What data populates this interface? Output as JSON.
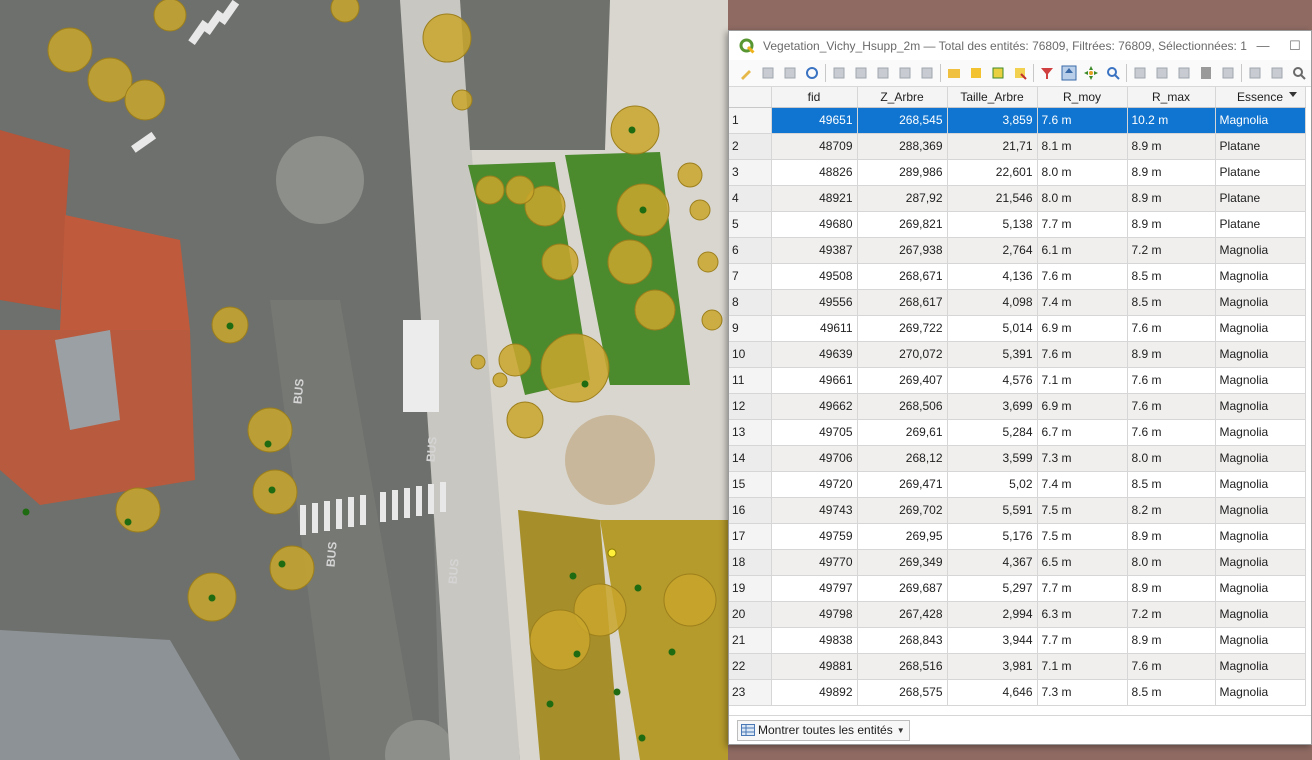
{
  "window": {
    "title": "Vegetation_Vichy_Hsupp_2m — Total des entités: 76809, Filtrées: 76809, Sélectionnées: 1",
    "minimize_glyph": "—",
    "maximize_glyph": "☐"
  },
  "toolbar": {
    "icons": [
      "toggle-editing-pencil-icon",
      "multi-edit-icon",
      "save-edits-icon",
      "reload-icon",
      "add-feature-icon",
      "delete-feature-icon",
      "cut-icon",
      "copy-icon",
      "paste-icon",
      "select-by-expression-icon",
      "select-all-icon",
      "invert-selection-icon",
      "deselect-all-icon",
      "filter-icon",
      "move-selection-to-top-icon",
      "pan-map-icon",
      "zoom-to-selection-icon",
      "copy-selected-rows-icon",
      "paste-features-icon",
      "delete-field-icon",
      "field-calculator-icon",
      "conditional-formatting-icon",
      "dock-table-icon",
      "table-view-icon",
      "form-view-icon"
    ]
  },
  "table": {
    "columns": [
      "fid",
      "Z_Arbre",
      "Taille_Arbre",
      "R_moy",
      "R_max",
      "Essence"
    ],
    "selected_row": 1,
    "rows": [
      [
        "1",
        "49651",
        "268,545",
        "3,859",
        "7.6 m",
        "10.2 m",
        "Magnolia"
      ],
      [
        "2",
        "48709",
        "288,369",
        "21,71",
        "8.1 m",
        "8.9 m",
        "Platane"
      ],
      [
        "3",
        "48826",
        "289,986",
        "22,601",
        "8.0 m",
        "8.9 m",
        "Platane"
      ],
      [
        "4",
        "48921",
        "287,92",
        "21,546",
        "8.0 m",
        "8.9 m",
        "Platane"
      ],
      [
        "5",
        "49680",
        "269,821",
        "5,138",
        "7.7 m",
        "8.9 m",
        "Platane"
      ],
      [
        "6",
        "49387",
        "267,938",
        "2,764",
        "6.1 m",
        "7.2 m",
        "Magnolia"
      ],
      [
        "7",
        "49508",
        "268,671",
        "4,136",
        "7.6 m",
        "8.5 m",
        "Magnolia"
      ],
      [
        "8",
        "49556",
        "268,617",
        "4,098",
        "7.4 m",
        "8.5 m",
        "Magnolia"
      ],
      [
        "9",
        "49611",
        "269,722",
        "5,014",
        "6.9 m",
        "7.6 m",
        "Magnolia"
      ],
      [
        "10",
        "49639",
        "270,072",
        "5,391",
        "7.6 m",
        "8.9 m",
        "Magnolia"
      ],
      [
        "11",
        "49661",
        "269,407",
        "4,576",
        "7.1 m",
        "7.6 m",
        "Magnolia"
      ],
      [
        "12",
        "49662",
        "268,506",
        "3,699",
        "6.9 m",
        "7.6 m",
        "Magnolia"
      ],
      [
        "13",
        "49705",
        "269,61",
        "5,284",
        "6.7 m",
        "7.6 m",
        "Magnolia"
      ],
      [
        "14",
        "49706",
        "268,12",
        "3,599",
        "7.3 m",
        "8.0 m",
        "Magnolia"
      ],
      [
        "15",
        "49720",
        "269,471",
        "5,02",
        "7.4 m",
        "8.5 m",
        "Magnolia"
      ],
      [
        "16",
        "49743",
        "269,702",
        "5,591",
        "7.5 m",
        "8.2 m",
        "Magnolia"
      ],
      [
        "17",
        "49759",
        "269,95",
        "5,176",
        "7.5 m",
        "8.9 m",
        "Magnolia"
      ],
      [
        "18",
        "49770",
        "269,349",
        "4,367",
        "6.5 m",
        "8.0 m",
        "Magnolia"
      ],
      [
        "19",
        "49797",
        "269,687",
        "5,297",
        "7.7 m",
        "8.9 m",
        "Magnolia"
      ],
      [
        "20",
        "49798",
        "267,428",
        "2,994",
        "6.3 m",
        "7.2 m",
        "Magnolia"
      ],
      [
        "21",
        "49838",
        "268,843",
        "3,944",
        "7.7 m",
        "8.9 m",
        "Magnolia"
      ],
      [
        "22",
        "49881",
        "268,516",
        "3,981",
        "7.1 m",
        "7.6 m",
        "Magnolia"
      ],
      [
        "23",
        "49892",
        "268,575",
        "4,646",
        "7.3 m",
        "8.5 m",
        "Magnolia"
      ]
    ]
  },
  "bottom": {
    "show_all_label": "Montrer toutes les entités"
  },
  "map": {
    "labels": [
      "BUS",
      "BUS",
      "BUS",
      "BUS"
    ]
  },
  "colors": {
    "selection": "#1075d0",
    "tree_buffer": "#c9a62b",
    "tree_point": "#1f6b12",
    "lawn": "#4c8a2e",
    "road": "#6d706c"
  }
}
